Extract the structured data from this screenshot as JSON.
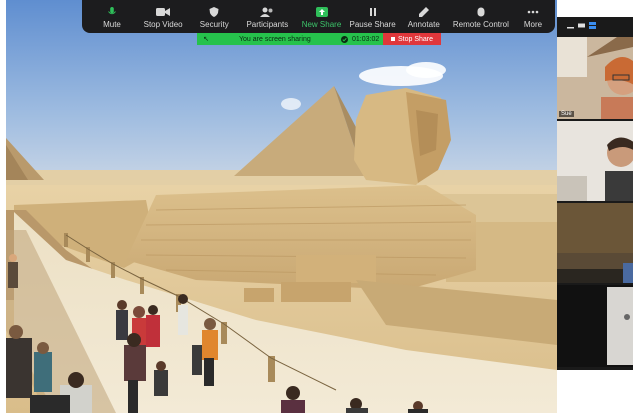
{
  "toolbar": {
    "items": [
      {
        "label": "Mute",
        "icon": "microphone-icon"
      },
      {
        "label": "Stop Video",
        "icon": "video-camera-icon"
      },
      {
        "label": "Security",
        "icon": "shield-icon"
      },
      {
        "label": "Participants",
        "icon": "participants-icon"
      },
      {
        "label": "New Share",
        "icon": "share-screen-icon"
      },
      {
        "label": "Pause Share",
        "icon": "pause-icon"
      },
      {
        "label": "Annotate",
        "icon": "pencil-icon"
      },
      {
        "label": "Remote Control",
        "icon": "mouse-icon"
      },
      {
        "label": "More",
        "icon": "ellipsis-icon"
      }
    ]
  },
  "share_banner": {
    "status": "You are screen sharing",
    "timer": "01:03:02",
    "stop_label": "Stop Share"
  },
  "participants": {
    "tiles": [
      {
        "name": "Sue"
      },
      {
        "name": ""
      },
      {
        "name": ""
      },
      {
        "name": ""
      }
    ]
  },
  "colors": {
    "toolbar_bg": "#1c1c1e",
    "share_green": "#26c24c",
    "stop_red": "#e0373b",
    "new_share_green": "#3cc46a"
  }
}
